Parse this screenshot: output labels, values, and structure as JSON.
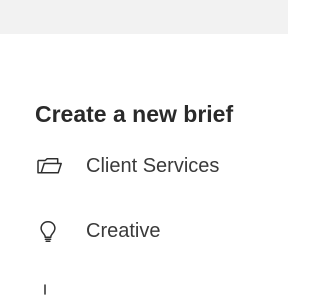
{
  "brief_menu": {
    "title": "Create a new brief",
    "options": [
      {
        "label": "Client Services",
        "icon": "folder-icon"
      },
      {
        "label": "Creative",
        "icon": "lightbulb-icon"
      }
    ],
    "partial_option": {
      "icon": "partial-option-icon"
    }
  }
}
